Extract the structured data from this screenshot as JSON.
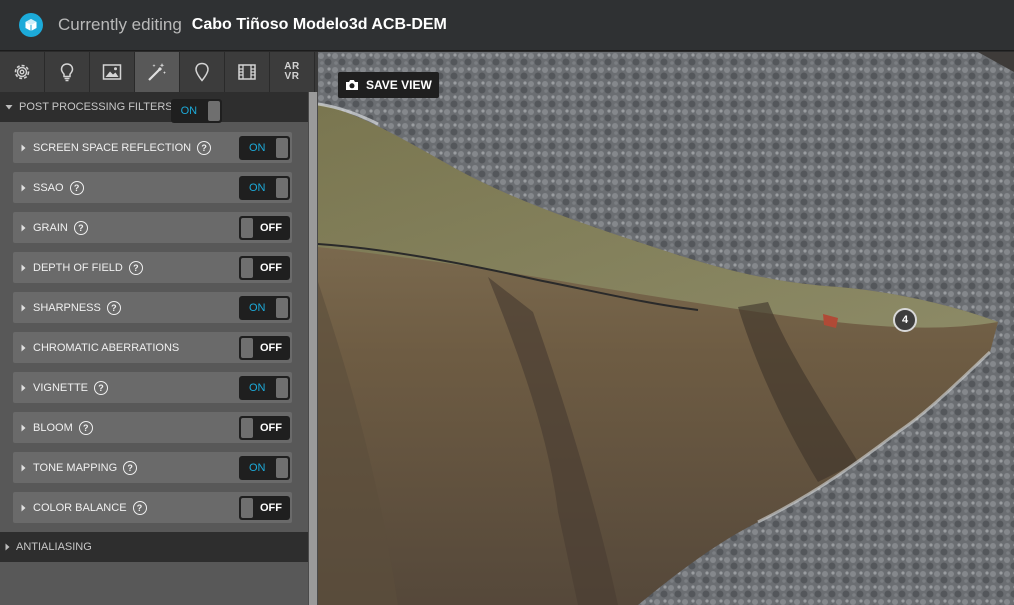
{
  "app": {
    "editing_label": "Currently editing",
    "model_title": "Cabo Tiñoso Modelo3d ACB-DEM",
    "brand_color": "#1caad9"
  },
  "tabs": [
    {
      "name": "general-settings",
      "icon": "gear-icon",
      "active": false
    },
    {
      "name": "lighting",
      "icon": "lightbulb-icon",
      "active": false
    },
    {
      "name": "background",
      "icon": "image-icon",
      "active": false
    },
    {
      "name": "post-processing",
      "icon": "magic-wand-icon",
      "active": true
    },
    {
      "name": "annotations",
      "icon": "map-pin-icon",
      "active": false
    },
    {
      "name": "animation",
      "icon": "film-icon",
      "active": false
    },
    {
      "name": "ar-vr",
      "icon": "ar-vr-icon",
      "label_top": "AR",
      "label_bottom": "VR",
      "active": false
    }
  ],
  "post_processing": {
    "title": "POST PROCESSING FILTERS",
    "state": "ON",
    "filters": [
      {
        "label": "SCREEN SPACE REFLECTION",
        "help": true,
        "state": "ON"
      },
      {
        "label": "SSAO",
        "help": true,
        "state": "ON"
      },
      {
        "label": "GRAIN",
        "help": true,
        "state": "OFF"
      },
      {
        "label": "DEPTH OF FIELD",
        "help": true,
        "state": "OFF"
      },
      {
        "label": "SHARPNESS",
        "help": true,
        "state": "ON"
      },
      {
        "label": "CHROMATIC ABERRATIONS",
        "help": false,
        "state": "OFF"
      },
      {
        "label": "VIGNETTE",
        "help": true,
        "state": "ON"
      },
      {
        "label": "BLOOM",
        "help": true,
        "state": "OFF"
      },
      {
        "label": "TONE MAPPING",
        "help": true,
        "state": "ON"
      },
      {
        "label": "COLOR BALANCE",
        "help": true,
        "state": "OFF"
      }
    ]
  },
  "antialiasing": {
    "title": "ANTIALIASING"
  },
  "viewport": {
    "save_view_label": "SAVE VIEW",
    "annotation_number": "4"
  }
}
